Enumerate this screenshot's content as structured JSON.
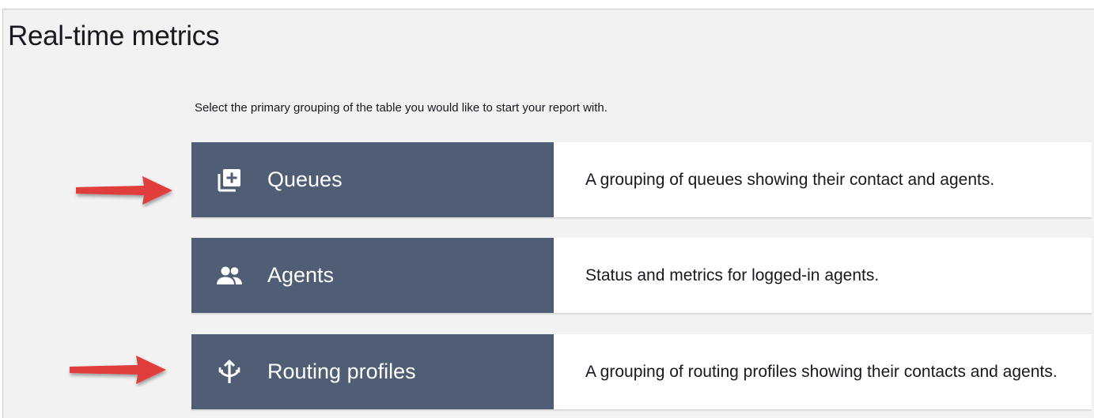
{
  "page": {
    "title": "Real-time metrics",
    "instruction": "Select the primary grouping of the table you would like to start your report with."
  },
  "options": [
    {
      "title": "Queues",
      "icon": "add-queue-icon",
      "description": "A grouping of queues showing their contact and agents."
    },
    {
      "title": "Agents",
      "icon": "people-icon",
      "description": "Status and metrics for logged-in agents."
    },
    {
      "title": "Routing profiles",
      "icon": "routing-icon",
      "description": "A grouping of routing profiles showing their contacts and agents."
    }
  ],
  "annotations": {
    "arrow_color": "#e03c3c",
    "highlighted_options": [
      "Queues",
      "Routing profiles"
    ]
  },
  "colors": {
    "option_label_bg": "#4f5e74",
    "page_bg": "#f2f2f2"
  }
}
